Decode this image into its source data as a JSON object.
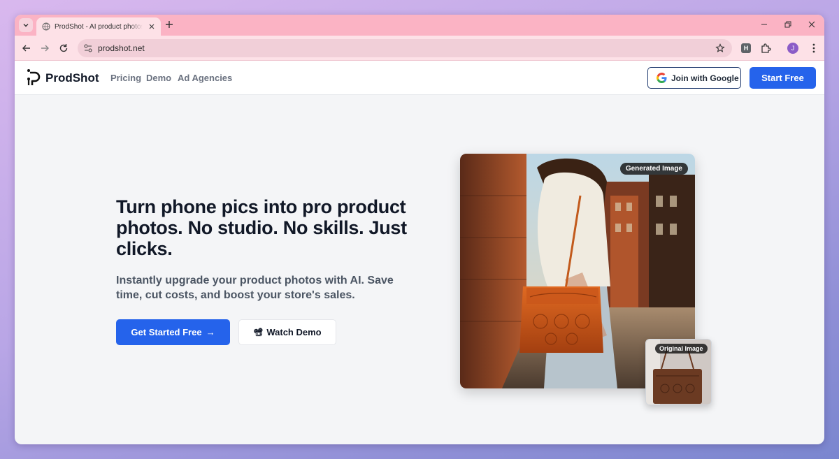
{
  "browser": {
    "tab_title": "ProdShot - AI product photos f",
    "url": "prodshot.net",
    "avatar_letter": "J",
    "extension_letter": "H"
  },
  "header": {
    "brand": "ProdShot",
    "nav": [
      "Pricing",
      "Demo",
      "Ad Agencies"
    ],
    "google_button": "Join with Google",
    "start_button": "Start Free"
  },
  "hero": {
    "title": "Turn phone pics into pro product photos. No studio. No skills. Just clicks.",
    "subtitle": "Instantly upgrade your product photos with AI. Save time, cut costs, and boost your store's sales.",
    "cta_label": "Get Started Free",
    "cta_arrow": "→",
    "demo_label": "Watch Demo",
    "demo_icon": "📽"
  },
  "images": {
    "generated_label": "Generated Image",
    "original_label": "Original Image"
  },
  "colors": {
    "accent": "#2563eb",
    "tabbar": "#fbb3c4",
    "toolbar": "#fde1e7"
  }
}
